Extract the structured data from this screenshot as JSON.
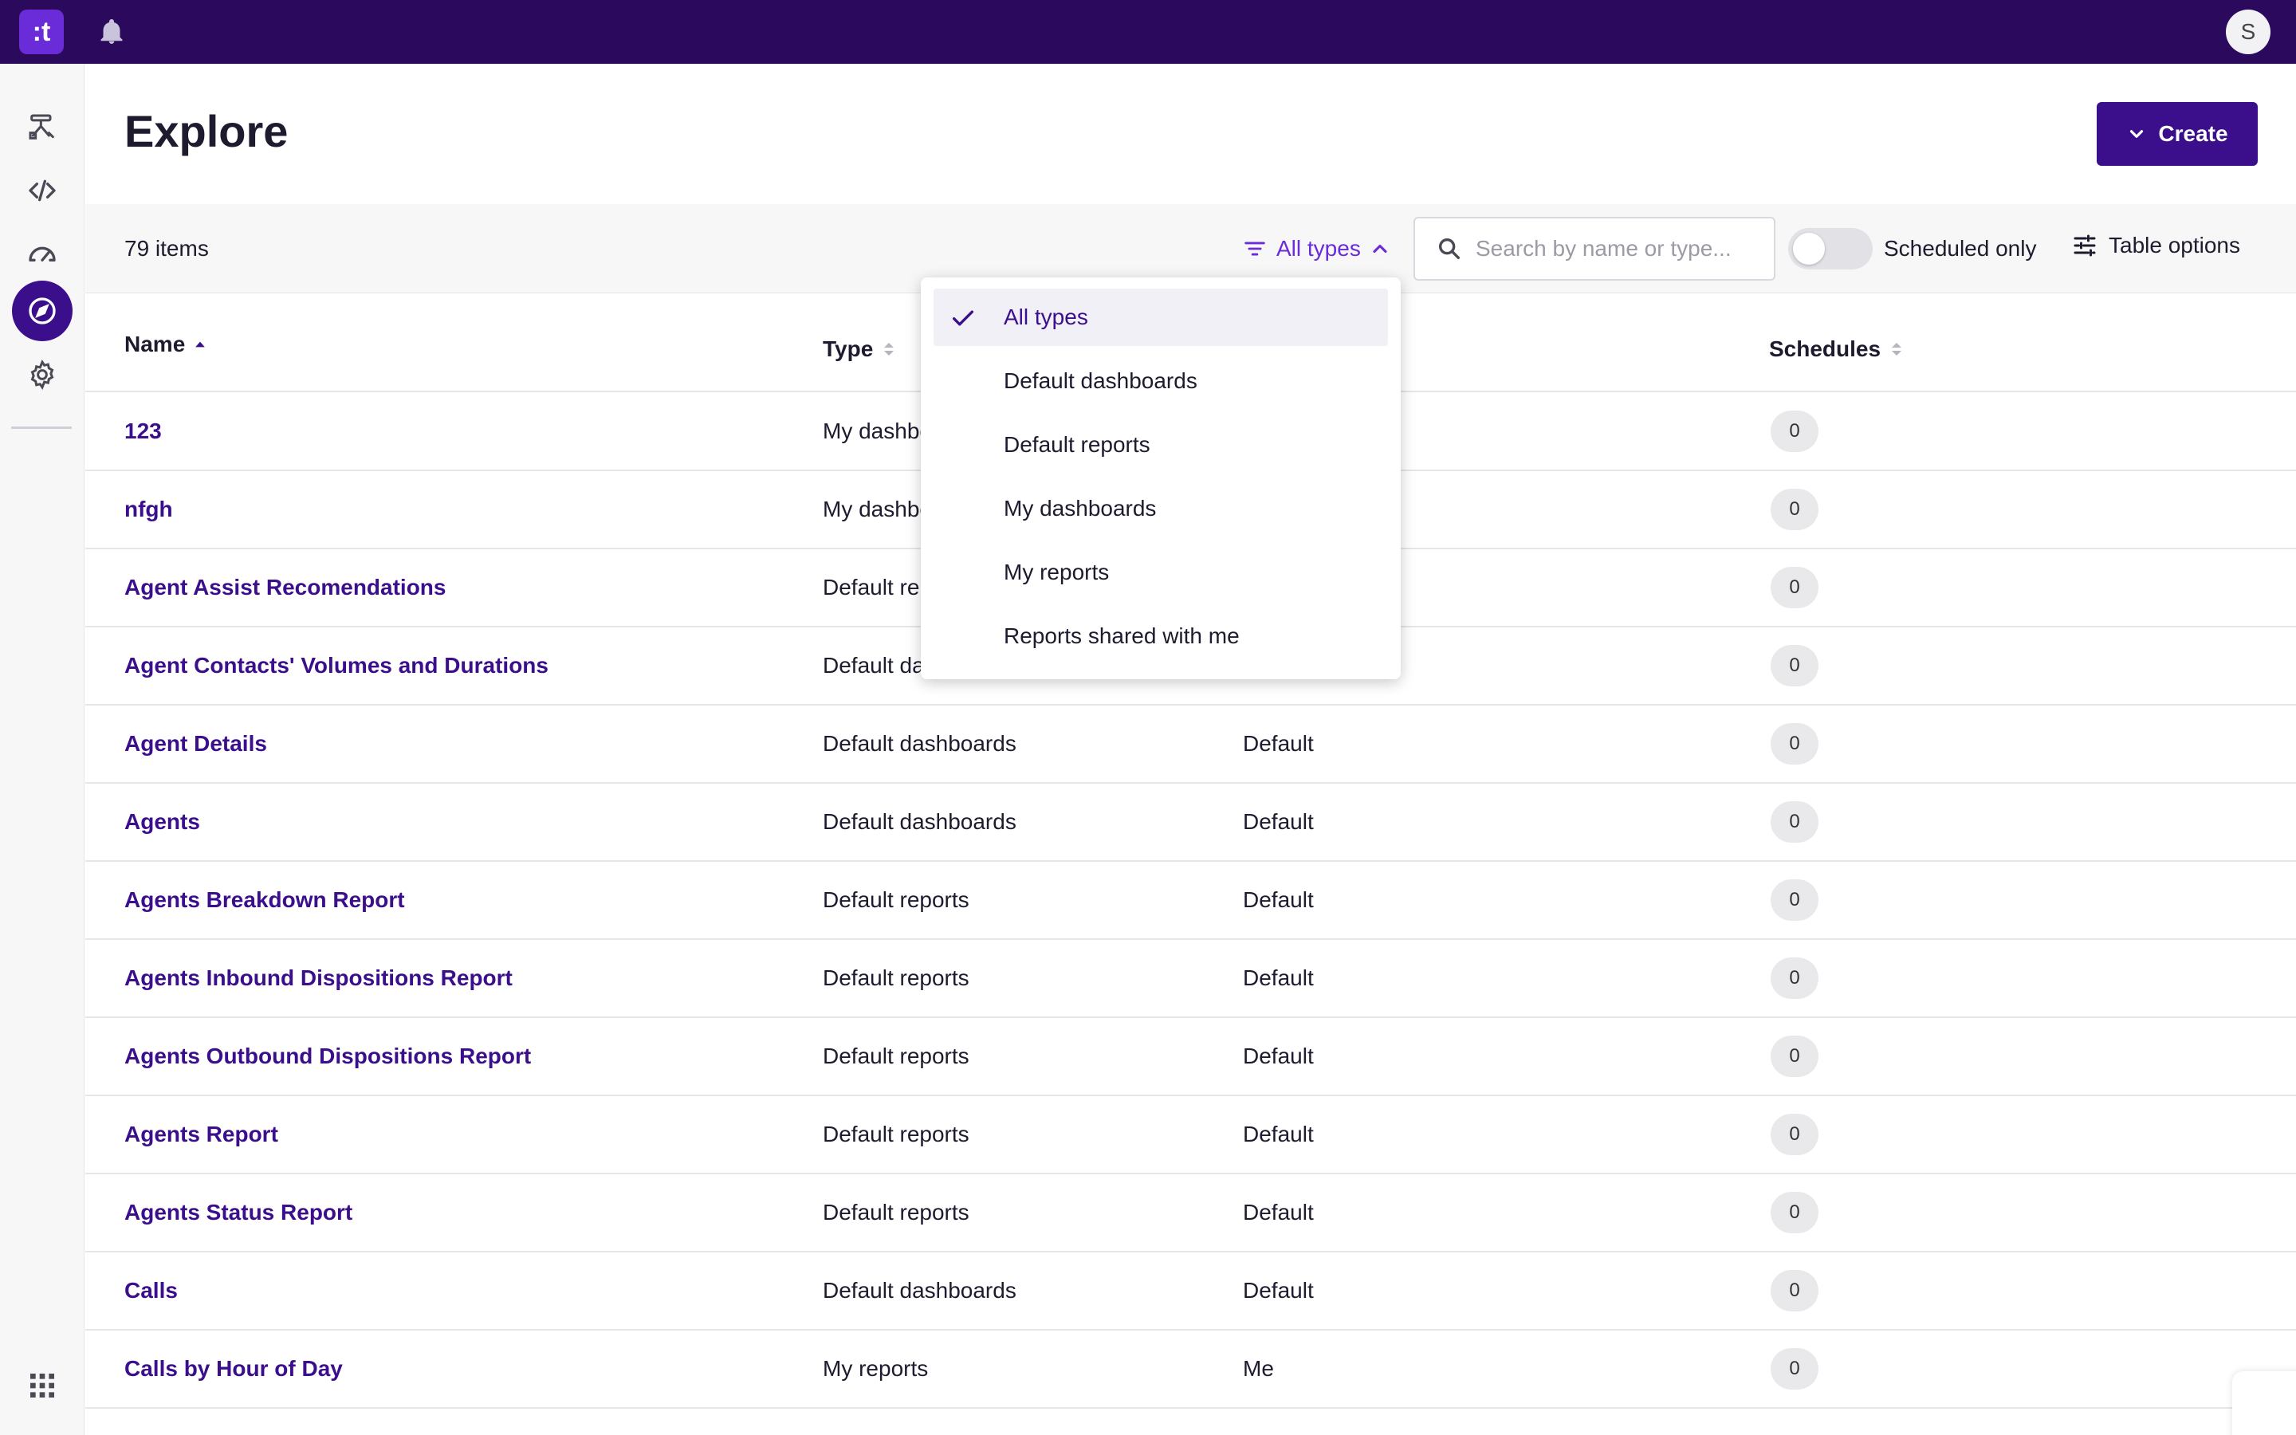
{
  "topbar": {
    "logo_text": ":t",
    "avatar_initial": "S",
    "colors": {
      "bar": "#2b0a5e",
      "logo": "#6a2bd9"
    }
  },
  "rail": {
    "items": [
      {
        "icon": "workflow-icon"
      },
      {
        "icon": "code-icon"
      },
      {
        "icon": "speedometer-icon"
      },
      {
        "icon": "compass-icon",
        "active": true
      },
      {
        "icon": "gear-icon"
      }
    ],
    "bottom_icon": "app-grid-icon"
  },
  "header": {
    "title": "Explore",
    "create_label": "Create"
  },
  "toolbar": {
    "items_count": "79 items",
    "type_filter_label": "All types",
    "search_placeholder": "Search by name or type...",
    "scheduled_label": "Scheduled only",
    "scheduled_on": false,
    "table_options_label": "Table options"
  },
  "table": {
    "columns": {
      "name": "Name",
      "type": "Type",
      "schedules": "Schedules"
    },
    "rows": [
      {
        "name": "123",
        "type": "My dashbo",
        "owner": "",
        "schedules": "0"
      },
      {
        "name": "nfgh",
        "type": "My dashbo",
        "owner": "",
        "schedules": "0"
      },
      {
        "name": "Agent Assist Recomendations",
        "type": "Default re",
        "owner": "",
        "schedules": "0"
      },
      {
        "name": "Agent Contacts' Volumes and Durations",
        "type": "Default da",
        "owner": "",
        "schedules": "0"
      },
      {
        "name": "Agent Details",
        "type": "Default dashboards",
        "owner": "Default",
        "schedules": "0"
      },
      {
        "name": "Agents",
        "type": "Default dashboards",
        "owner": "Default",
        "schedules": "0"
      },
      {
        "name": "Agents Breakdown Report",
        "type": "Default reports",
        "owner": "Default",
        "schedules": "0"
      },
      {
        "name": "Agents Inbound Dispositions Report",
        "type": "Default reports",
        "owner": "Default",
        "schedules": "0"
      },
      {
        "name": "Agents Outbound Dispositions Report",
        "type": "Default reports",
        "owner": "Default",
        "schedules": "0"
      },
      {
        "name": "Agents Report",
        "type": "Default reports",
        "owner": "Default",
        "schedules": "0"
      },
      {
        "name": "Agents Status Report",
        "type": "Default reports",
        "owner": "Default",
        "schedules": "0"
      },
      {
        "name": "Calls",
        "type": "Default dashboards",
        "owner": "Default",
        "schedules": "0"
      },
      {
        "name": "Calls by Hour of Day",
        "type": "My reports",
        "owner": "Me",
        "schedules": "0"
      }
    ]
  },
  "type_dropdown": {
    "selected": "All types",
    "options": [
      "All types",
      "Default dashboards",
      "Default reports",
      "My dashboards",
      "My reports",
      "Reports shared with me"
    ]
  },
  "colors": {
    "accent": "#3b0f8c",
    "accent_light": "#6a2bd9"
  }
}
